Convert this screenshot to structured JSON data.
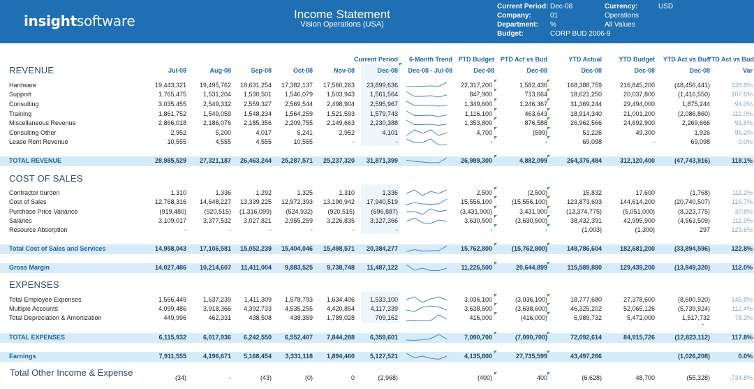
{
  "header": {
    "logo_bold": "insight",
    "logo_light": "software",
    "title": "Income Statement",
    "subtitle": "Vision Operations (USA)",
    "meta": {
      "period_label": "Current Period:",
      "period_value": "Dec-08",
      "currency_label": "Currency:",
      "currency_value": "USD",
      "company_label": "Company:",
      "company_value": "01",
      "company_name": "Operations",
      "department_label": "Department:",
      "department_value": "%",
      "department_name": "All Values",
      "budget_label": "Budget:",
      "budget_value": "CORP BUD 2006-9"
    }
  },
  "columns": {
    "current_period": "Current Period",
    "trend": "6-Month Trend",
    "ptd_budget": "PTD Budget",
    "ptd_act_vs_bud": "PTD Act vs Bud",
    "ytd_actual": "YTD Actual",
    "ytd_budget": "YTD Budget",
    "ytd_act_vs_bud": "YTD Act vs Bud",
    "ytd_act_vs_bud_var": "YTD Act vs Bud",
    "months": [
      "Jul-08",
      "Aug-08",
      "Sep-08",
      "Oct-08",
      "Nov-08",
      "Dec-08"
    ],
    "trend_range": "Dec-08 - Jul-08",
    "ptd_budget_sub": "Dec-08",
    "ptd_act_vs_bud_sub": "Dec-08",
    "ytd_actual_sub": "Dec-08",
    "ytd_budget_sub": "Dec-08",
    "ytd_act_vs_bud_sub": "Dec-08",
    "var_sub": "Var"
  },
  "sections": {
    "revenue": "REVENUE",
    "cost_of_sales": "COST OF SALES",
    "expenses": "EXPENSES",
    "total_other": "Total Other Income & Expense"
  },
  "rows": [
    {
      "label": "Hardware",
      "m": [
        "19,443,321",
        "19,495,762",
        "18,631,254",
        "17,382,137",
        "17,560,263",
        "23,899,636"
      ],
      "ptd": "22,317,200",
      "ptdv": "1,582,436",
      "ytd": "168,388,759",
      "ytdb": "216,845,200",
      "ytdv": "(48,456,441)",
      "var": "128.8%",
      "trend": [
        0.3,
        0.3,
        0.35,
        0.4,
        0.35,
        0.9
      ]
    },
    {
      "label": "Support",
      "m": [
        "1,765,475",
        "1,531,204",
        "1,530,501",
        "1,546,079",
        "1,503,943",
        "1,561,564"
      ],
      "ptd": "847,900",
      "ptdv": "713,664",
      "ytd": "18,621,250",
      "ytdb": "20,037,800",
      "ytdv": "(1,416,550)",
      "var": "107.6%",
      "trend": [
        0.9,
        0.2,
        0.2,
        0.3,
        0.1,
        0.4
      ]
    },
    {
      "label": "Consulting",
      "m": [
        "3,035,455",
        "2,549,332",
        "2,559,327",
        "2,569,544",
        "2,498,904",
        "2,595,967"
      ],
      "ptd": "1,349,600",
      "ptdv": "1,246,367",
      "ytd": "31,369,244",
      "ytdb": "29,494,000",
      "ytdv": "1,875,244",
      "var": "94.0%",
      "trend": [
        0.9,
        0.3,
        0.3,
        0.35,
        0.2,
        0.35
      ]
    },
    {
      "label": "Training",
      "m": [
        "1,861,752",
        "1,549,059",
        "1,548,234",
        "1,564,259",
        "1,521,593",
        "1,579,743"
      ],
      "ptd": "1,116,100",
      "ptdv": "463,643",
      "ytd": "18,914,340",
      "ytdb": "21,001,200",
      "ytdv": "(2,086,860)",
      "var": "111.0%",
      "trend": [
        0.9,
        0.25,
        0.25,
        0.3,
        0.1,
        0.35
      ]
    },
    {
      "label": "Miscellaneous Revenue",
      "m": [
        "2,866,018",
        "2,186,076",
        "2,185,356",
        "2,209,755",
        "2,149,663",
        "2,230,388"
      ],
      "ptd": "1,353,800",
      "ptdv": "876,588",
      "ytd": "26,962,566",
      "ytdb": "24,692,900",
      "ytdv": "2,269,666",
      "var": "91.6%",
      "trend": [
        0.9,
        0.25,
        0.25,
        0.3,
        0.15,
        0.35
      ]
    },
    {
      "label": "Consulting Other",
      "m": [
        "2,952",
        "5,200",
        "4,017",
        "5,241",
        "2,952",
        "4,101"
      ],
      "ptd": "4,700",
      "ptdv": "(599)",
      "ytd": "51,226",
      "ytdb": "49,300",
      "ytdv": "1,926",
      "var": "96.2%",
      "trend": [
        0.1,
        0.9,
        0.4,
        0.9,
        0.1,
        0.5
      ]
    },
    {
      "label": "Lease Rent Revenue",
      "m": [
        "10,555",
        "4,555",
        "4,555",
        "10,555",
        "-",
        "-"
      ],
      "ptd": "-",
      "ptdv": "-",
      "ytd": "69,098",
      "ytdb": "-",
      "ytdv": "69,098",
      "var": "0.0%",
      "trend": [
        0.9,
        0.4,
        0.4,
        0.9,
        0.05,
        0.05
      ]
    },
    {
      "label": "TOTAL REVENUE",
      "m": [
        "28,985,529",
        "27,321,187",
        "26,463,244",
        "25,287,571",
        "25,237,320",
        "31,871,399"
      ],
      "ptd": "26,989,300",
      "ptdv": "4,882,099",
      "ytd": "264,376,484",
      "ytdb": "312,120,400",
      "ytdv": "(47,743,916)",
      "var": "118.1%",
      "trend": [
        0.55,
        0.4,
        0.3,
        0.2,
        0.2,
        0.9
      ]
    },
    {
      "label": "Contractor burden",
      "m": [
        "1,310",
        "1,336",
        "1,292",
        "1,325",
        "1,310",
        "1,336"
      ],
      "ptd": "2,500",
      "ptdv": "(2,500)",
      "ytd": "15,832",
      "ytdb": "17,600",
      "ytdv": "(1,768)",
      "var": "111.2%",
      "trend": [
        0.4,
        0.9,
        0.1,
        0.7,
        0.4,
        0.9
      ]
    },
    {
      "label": "Cost of Sales",
      "m": [
        "12,768,316",
        "14,648,227",
        "13,339,225",
        "12,972,393",
        "13,190,942",
        "17,940,519"
      ],
      "ptd": "15,556,100",
      "ptdv": "(15,556,100)",
      "ytd": "123,873,693",
      "ytdb": "144,614,200",
      "ytdv": "(20,740,507)",
      "var": "116.7%",
      "trend": [
        0.1,
        0.4,
        0.2,
        0.15,
        0.2,
        0.9
      ]
    },
    {
      "label": "Purchase Price Variance",
      "m": [
        "(919,480)",
        "(920,515)",
        "(1,316,099)",
        "(524,932)",
        "(920,515)",
        "(696,887)"
      ],
      "ptd": "(3,431,900)",
      "ptdv": "3,431,900",
      "ytd": "(13,374,775)",
      "ytdb": "(5,051,000)",
      "ytdv": "(8,323,775)",
      "var": "37.8%",
      "trend": [
        0.5,
        0.5,
        0.1,
        0.9,
        0.5,
        0.7
      ]
    },
    {
      "label": "Salaries",
      "m": [
        "3,109,017",
        "3,377,532",
        "3,027,821",
        "2,955,259",
        "3,226,835",
        "3,127,366"
      ],
      "ptd": "3,630,500",
      "ptdv": "(3,630,500)",
      "ytd": "38,432,391",
      "ytdb": "42,995,900",
      "ytdv": "(4,563,509)",
      "var": "111.9%",
      "trend": [
        0.4,
        0.9,
        0.2,
        0.1,
        0.6,
        0.4
      ]
    },
    {
      "label": "Resource Absorption",
      "m": [
        "-",
        "-",
        "-",
        "-",
        "-",
        "-"
      ],
      "ptd": "-",
      "ptdv": "-",
      "ytd": "(1,003)",
      "ytdb": "(1,300)",
      "ytdv": "297",
      "var": "129.6%",
      "trend": []
    },
    {
      "label": "Total Cost of Sales and Services",
      "m": [
        "14,958,043",
        "17,106,581",
        "15,052,239",
        "15,404,046",
        "15,498,571",
        "20,384,277"
      ],
      "ptd": "15,762,800",
      "ptdv": "(15,762,800)",
      "ytd": "148,786,604",
      "ytdb": "182,681,200",
      "ytdv": "(33,894,596)",
      "var": "122.8%",
      "trend": [
        0.1,
        0.35,
        0.15,
        0.2,
        0.2,
        0.9
      ]
    },
    {
      "label": "Gross Margin",
      "m": [
        "14,027,486",
        "10,214,607",
        "11,411,004",
        "9,883,525",
        "9,738,748",
        "11,487,122"
      ],
      "ptd": "11,226,500",
      "ptdv": "20,644,899",
      "ytd": "115,589,880",
      "ytdb": "129,439,200",
      "ytdv": "(13,849,320)",
      "var": "112.0%",
      "trend": [
        0.9,
        0.1,
        0.4,
        0.05,
        0.05,
        0.4
      ]
    },
    {
      "label": "Total Employee Expenses",
      "m": [
        "1,566,449",
        "1,637,239",
        "1,411,309",
        "1,578,793",
        "1,634,406",
        "1,533,100"
      ],
      "ptd": "3,036,100",
      "ptdv": "(3,036,100)",
      "ytd": "18,777,680",
      "ytdb": "27,378,600",
      "ytdv": "(8,600,920)",
      "var": "145.8%",
      "trend": [
        0.5,
        0.9,
        0.1,
        0.6,
        0.9,
        0.4
      ]
    },
    {
      "label": "Multiple Accounts",
      "m": [
        "4,099,486",
        "3,918,366",
        "4,392,733",
        "4,535,255",
        "4,420,854",
        "4,117,339"
      ],
      "ptd": "3,638,600",
      "ptdv": "(3,638,600)",
      "ytd": "46,325,202",
      "ytdb": "52,065,126",
      "ytdv": "(5,739,924)",
      "var": "112.4%",
      "trend": [
        0.3,
        0.1,
        0.7,
        0.9,
        0.75,
        0.3
      ]
    },
    {
      "label": "Total Depreciation & Amortization",
      "m": [
        "449,996",
        "462,331",
        "438,508",
        "438,359",
        "1,789,028",
        "709,162"
      ],
      "ptd": "416,000",
      "ptdv": "(416,000)",
      "ytd": "6,989,732",
      "ytdb": "5,472,000",
      "ytdv": "1,517,732",
      "var": "78.3%",
      "trend": [
        0.1,
        0.12,
        0.1,
        0.1,
        0.9,
        0.3
      ]
    },
    {
      "label": "TOTAL EXPENSES",
      "m": [
        "6,115,932",
        "6,017,936",
        "6,242,550",
        "6,552,407",
        "7,844,288",
        "6,359,601"
      ],
      "ptd": "7,090,700",
      "ptdv": "(7,090,700)",
      "ytd": "72,092,614",
      "ytdb": "84,915,726",
      "ytdv": "(12,823,112)",
      "var": "117.8%",
      "trend": [
        0.1,
        0.05,
        0.15,
        0.3,
        0.9,
        0.25
      ]
    },
    {
      "label": "Earnings",
      "m": [
        "7,911,555",
        "4,196,671",
        "5,168,454",
        "3,331,118",
        "1,894,460",
        "5,127,521"
      ],
      "ptd": "4,135,800",
      "ptdv": "27,735,599",
      "ytd": "43,497,266",
      "ytdb": "",
      "ytdv": "(1,026,208)",
      "var": "0.0%",
      "trend": [
        0.9,
        0.3,
        0.5,
        0.2,
        0.05,
        0.5
      ]
    },
    {
      "label": "",
      "m": [
        "(34)",
        "-",
        "(43)",
        "(0)",
        "0",
        "(2,968)"
      ],
      "ptd": "(400)",
      "ptdv": "400",
      "ytd": "(6,628)",
      "ytdb": "48,700",
      "ytdv": "(55,328)",
      "var": "-734.8%",
      "trend": []
    }
  ],
  "extra": {
    "ytdv_dash": "-"
  }
}
